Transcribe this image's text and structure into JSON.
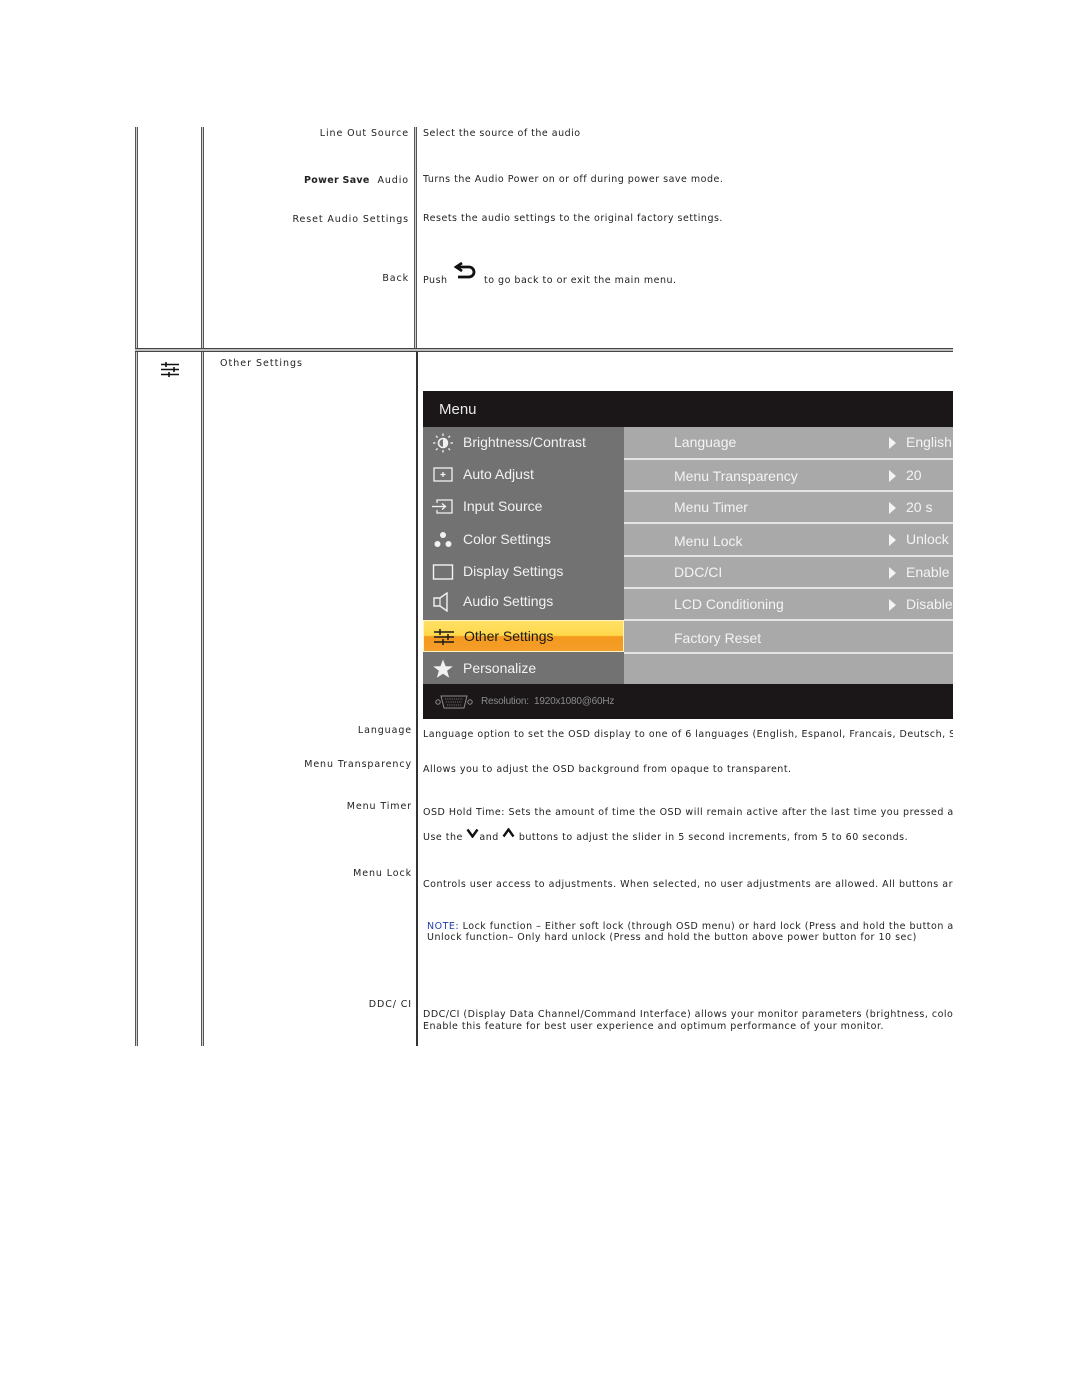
{
  "audio_section": {
    "rows": [
      {
        "label": "Line Out Source",
        "description": "Select the source of the audio"
      },
      {
        "label_bold": "Power Save",
        "label": "Audio",
        "description": "Turns the Audio Power on or off during power save mode."
      },
      {
        "label": "Reset Audio Settings",
        "description": "Resets the audio settings to the original factory settings."
      },
      {
        "label": "Back",
        "description_prefix": "Push",
        "icon": "back-arrow-icon",
        "description_suffix": "to go back to or exit the main menu."
      }
    ]
  },
  "other_settings_section": {
    "icon": "sliders-icon",
    "title": "Other Settings",
    "osd_menu": {
      "title": "Menu",
      "left_items": [
        {
          "label": "Brightness/Contrast",
          "icon": "brightness-icon"
        },
        {
          "label": "Auto Adjust",
          "icon": "auto-adjust-icon"
        },
        {
          "label": "Input Source",
          "icon": "input-source-icon"
        },
        {
          "label": "Color Settings",
          "icon": "color-settings-icon"
        },
        {
          "label": "Display Settings",
          "icon": "display-settings-icon"
        },
        {
          "label": "Audio Settings",
          "icon": "speaker-icon"
        },
        {
          "label": "Other Settings",
          "icon": "sliders-icon",
          "selected": true
        },
        {
          "label": "Personalize",
          "icon": "star-icon"
        }
      ],
      "right_items": [
        {
          "label": "Language",
          "value": "English"
        },
        {
          "label": "Menu Transparency",
          "value": "20"
        },
        {
          "label": "Menu Timer",
          "value": "20 s"
        },
        {
          "label": "Menu Lock",
          "value": "Unlock"
        },
        {
          "label": "DDC/CI",
          "value": "Enable"
        },
        {
          "label": "LCD Conditioning",
          "value": "Disable"
        },
        {
          "label": "Factory Reset",
          "value": ""
        }
      ],
      "footer": {
        "icon": "vga-connector-icon",
        "resolution_label": "Resolution:",
        "resolution_value": "1920x1080@60Hz"
      },
      "colors": {
        "header_bg": "#1b1617",
        "left_bg": "#727272",
        "right_bg": "#a9a9a9",
        "selected_top": "#ffe066",
        "selected_bottom": "#f39c2a"
      }
    },
    "rows": [
      {
        "label": "Language",
        "description": "Language option to set the OSD display to one of 6 languages (English, Espanol, Francais, Deutsch, Sim"
      },
      {
        "label": "Menu Transparency",
        "description": "Allows you to adjust the OSD background from opaque to transparent."
      },
      {
        "label": "Menu Timer",
        "description": "OSD Hold Time: Sets the amount of time the OSD will remain active after the last time you pressed a but",
        "description2_prefix": "Use the",
        "description2_mid": "and",
        "description2_suffix": "buttons to adjust the slider in 5 second increments, from 5 to 60 seconds."
      },
      {
        "label": "Menu Lock",
        "description": "Controls user access to adjustments. When selected, no user adjustments are allowed. All buttons are l",
        "note_keyword": "NOTE:",
        "note_line1": "Lock function – Either soft lock (through OSD menu) or hard lock (Press and hold the button abo",
        "note_line2": "Unlock function– Only hard unlock (Press and hold the button above power button for 10 sec)"
      },
      {
        "label": "DDC/ CI",
        "description": "DDC/CI (Display Data Channel/Command Interface) allows your monitor parameters (brightness, color b",
        "description2": "Enable this feature for best user experience and optimum performance of your monitor."
      }
    ]
  },
  "colors": {
    "note_keyword": "#1f3fa8"
  }
}
